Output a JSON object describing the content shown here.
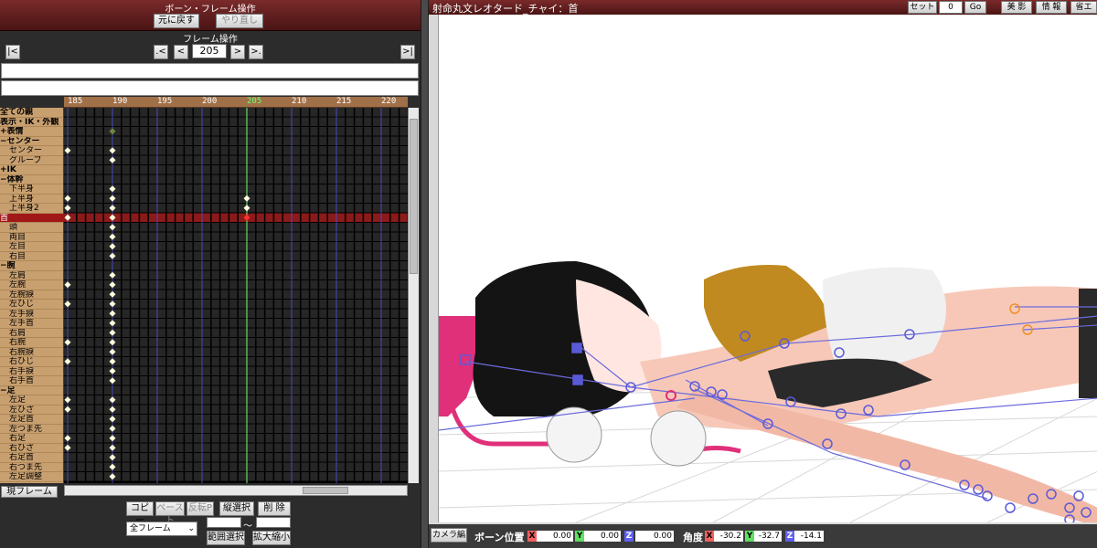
{
  "left_panel": {
    "title": "ボーン・フレーム操作",
    "undo_label": "元に戻す",
    "redo_label": "やり直し",
    "frame_ops_title": "フレーム操作",
    "nav_first": "|<",
    "nav_prev_key": ".<",
    "nav_prev": "<",
    "frame_number": "205",
    "nav_next": ">",
    "nav_next_key": ">.",
    "nav_last": ">|"
  },
  "timeline": {
    "ruler_labels": [
      "185",
      "190",
      "195",
      "200",
      "205",
      "210",
      "215",
      "220"
    ],
    "current_frame": "205",
    "bones": [
      {
        "name": "全ての親",
        "type": "grp"
      },
      {
        "name": "表示・IK・外観",
        "type": "grp"
      },
      {
        "name": "+表情",
        "type": "grp"
      },
      {
        "name": "−センター",
        "type": "grp"
      },
      {
        "name": "センター",
        "type": "sub"
      },
      {
        "name": "グルーブ",
        "type": "sub"
      },
      {
        "name": "+IK",
        "type": "grp"
      },
      {
        "name": "−体幹",
        "type": "grp"
      },
      {
        "name": "下半身",
        "type": "sub"
      },
      {
        "name": "上半身",
        "type": "sub"
      },
      {
        "name": "上半身2",
        "type": "sub"
      },
      {
        "name": "首",
        "type": "sel"
      },
      {
        "name": "頭",
        "type": "sub"
      },
      {
        "name": "両目",
        "type": "sub"
      },
      {
        "name": "左目",
        "type": "sub"
      },
      {
        "name": "右目",
        "type": "sub"
      },
      {
        "name": "−腕",
        "type": "grp"
      },
      {
        "name": "左肩",
        "type": "sub"
      },
      {
        "name": "左腕",
        "type": "sub"
      },
      {
        "name": "左腕捩",
        "type": "sub"
      },
      {
        "name": "左ひじ",
        "type": "sub"
      },
      {
        "name": "左手捩",
        "type": "sub"
      },
      {
        "name": "左手首",
        "type": "sub"
      },
      {
        "name": "右肩",
        "type": "sub"
      },
      {
        "name": "右腕",
        "type": "sub"
      },
      {
        "name": "右腕捩",
        "type": "sub"
      },
      {
        "name": "右ひじ",
        "type": "sub"
      },
      {
        "name": "右手捩",
        "type": "sub"
      },
      {
        "name": "右手首",
        "type": "sub"
      },
      {
        "name": "−足",
        "type": "grp"
      },
      {
        "name": "左足",
        "type": "sub"
      },
      {
        "name": "左ひざ",
        "type": "sub"
      },
      {
        "name": "左足首",
        "type": "sub"
      },
      {
        "name": "左つま先",
        "type": "sub"
      },
      {
        "name": "右足",
        "type": "sub"
      },
      {
        "name": "右ひざ",
        "type": "sub"
      },
      {
        "name": "右足首",
        "type": "sub"
      },
      {
        "name": "右つま先",
        "type": "sub"
      },
      {
        "name": "左足調整",
        "type": "sub"
      }
    ]
  },
  "bottom_panel": {
    "current_frame_label": "現フレーム",
    "copy_label": "コピー",
    "paste_label": "ペースト",
    "reverse_paste_label": "反転P",
    "vertical_select_label": "縦選択",
    "delete_label": "削 除",
    "frame_select_value": "全フレーム",
    "range_tilde": "～",
    "range_select_label": "範囲選択",
    "scale_label": "拡大縮小"
  },
  "viewport_panel": {
    "title": "射命丸文レオタード_チャイ：首",
    "set_label": "セット",
    "set_value": "0",
    "go_label": "Go",
    "beauty_label": "美 影",
    "info_label": "情 報",
    "save_label": "省エ"
  },
  "status_bar": {
    "camera_label": "カメラ編",
    "bone_pos_label": "ボーン位置",
    "pos_x": "0.00",
    "pos_y": "0.00",
    "pos_z": "0.00",
    "angle_label": "角度",
    "ang_x": "-30.2",
    "ang_y": "-32.7",
    "ang_z": "-14.1",
    "axis_x": "X",
    "axis_y": "Y",
    "axis_z": "Z"
  },
  "colors": {
    "title_red": "#5a1a1a",
    "ruler_brown": "#a07048",
    "bone_panel_tan": "#c8a070",
    "selected_row": "#8b1a1a",
    "current_frame_line": "#6fff6f",
    "keyframe": "#ffffe0",
    "bone_marker": "#5a5ad8"
  }
}
